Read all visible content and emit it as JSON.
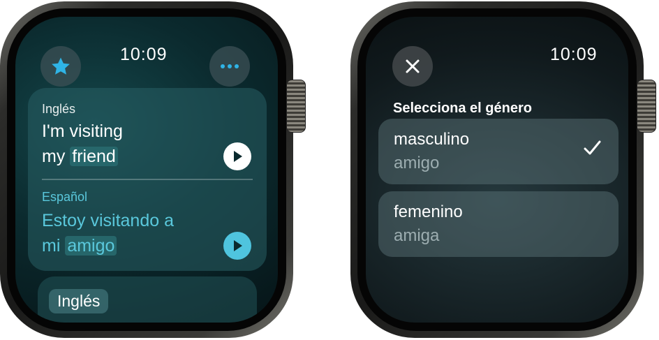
{
  "translator": {
    "time": "10:09",
    "favorite_icon": "star-icon",
    "more_icon": "ellipsis-icon",
    "source": {
      "language": "Inglés",
      "text_prefix": "I'm visiting",
      "text_line2_prefix": "my ",
      "highlight": "friend"
    },
    "target": {
      "language": "Español",
      "text_prefix": "Estoy visitando a",
      "text_line2_prefix": "mi ",
      "highlight": "amigo"
    },
    "next_language": "Inglés",
    "colors": {
      "accent": "#5ac8dc",
      "source_play": "#ffffff",
      "target_play": "#4fc4de"
    }
  },
  "gender_picker": {
    "time": "10:09",
    "close_icon": "close-icon",
    "title": "Selecciona el género",
    "options": [
      {
        "label": "masculino",
        "word": "amigo",
        "selected": true
      },
      {
        "label": "femenino",
        "word": "amiga",
        "selected": false
      }
    ]
  }
}
